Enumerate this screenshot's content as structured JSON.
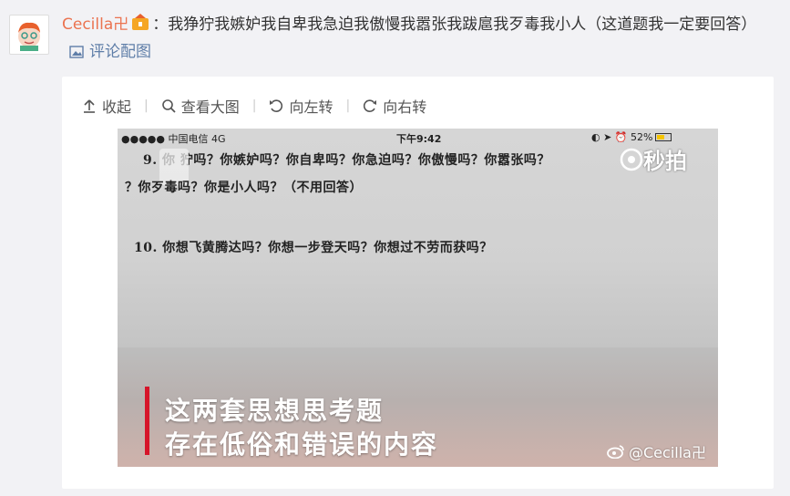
{
  "comment": {
    "username": "Cecilla卍",
    "text": "：我狰狞我嫉妒我自卑我急迫我傲慢我嚣张我跋扈我歹毒我小人（这道题我一定要回答）",
    "pic_link": "评论配图"
  },
  "toolbar": {
    "collapse": "收起",
    "view_large": "查看大图",
    "rotate_left": "向左转",
    "rotate_right": "向右转"
  },
  "photo": {
    "status": {
      "carrier": "●●●●● 中国电信  4G",
      "time": "下午9:42",
      "battery": "52%"
    },
    "watermark_top": "秒拍",
    "lines": {
      "l1": "9. 你   狞吗？你嫉妒吗？你自卑吗？你急迫吗？你傲慢吗？你嚣张吗？",
      "l2": "？你歹毒吗？你是小人吗？（不用回答）",
      "l3": "10. 你想飞黄腾达吗？你想一步登天吗？你想过不劳而获吗？"
    },
    "caption_1": "这两套思想思考题",
    "caption_2": "存在低俗和错误的内容",
    "weibo_watermark": "@Cecilla卍"
  }
}
